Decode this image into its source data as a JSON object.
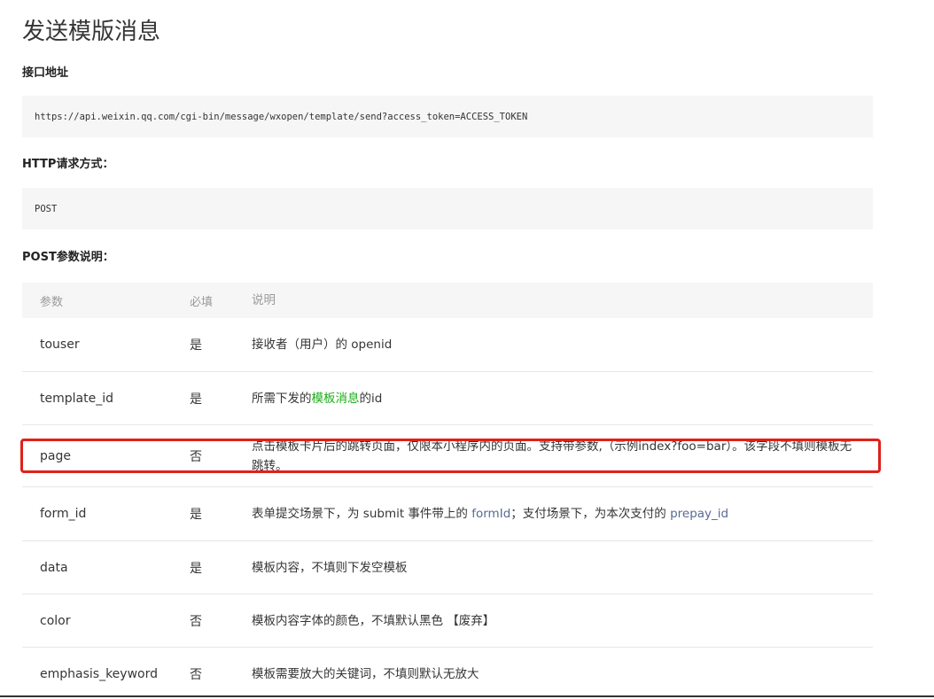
{
  "page": {
    "title": "发送模版消息"
  },
  "sections": {
    "url_heading": "接口地址",
    "url_value": "https://api.weixin.qq.com/cgi-bin/message/wxopen/template/send?access_token=ACCESS_TOKEN",
    "method_heading": "HTTP请求方式：",
    "method_value": "POST",
    "params_heading": "POST参数说明："
  },
  "table": {
    "headers": {
      "param": "参数",
      "required": "必填",
      "desc": "说明"
    },
    "rows": [
      {
        "param": "touser",
        "required": "是",
        "desc": "接收者（用户）的 openid"
      },
      {
        "param": "template_id",
        "required": "是",
        "desc_prefix": "所需下发的",
        "desc_link": "模板消息",
        "desc_suffix": "的id"
      },
      {
        "param": "page",
        "required": "否",
        "desc": "点击模板卡片后的跳转页面，仅限本小程序内的页面。支持带参数,（示例index?foo=bar）。该字段不填则模板无跳转。"
      },
      {
        "param": "form_id",
        "required": "是",
        "desc_part1": "表单提交场景下，为 submit 事件带上的 ",
        "desc_link1": "formId",
        "desc_part2": "；支付场景下，为本次支付的 ",
        "desc_link2": "prepay_id"
      },
      {
        "param": "data",
        "required": "是",
        "desc": "模板内容，不填则下发空模板"
      },
      {
        "param": "color",
        "required": "否",
        "desc": "模板内容字体的颜色，不填默认黑色 【废弃】"
      },
      {
        "param": "emphasis_keyword",
        "required": "否",
        "desc": "模板需要放大的关键词，不填则默认无放大"
      }
    ]
  },
  "colors": {
    "highlight_border": "#e0201a",
    "link": "#576b95",
    "link_green": "#1aad19"
  }
}
